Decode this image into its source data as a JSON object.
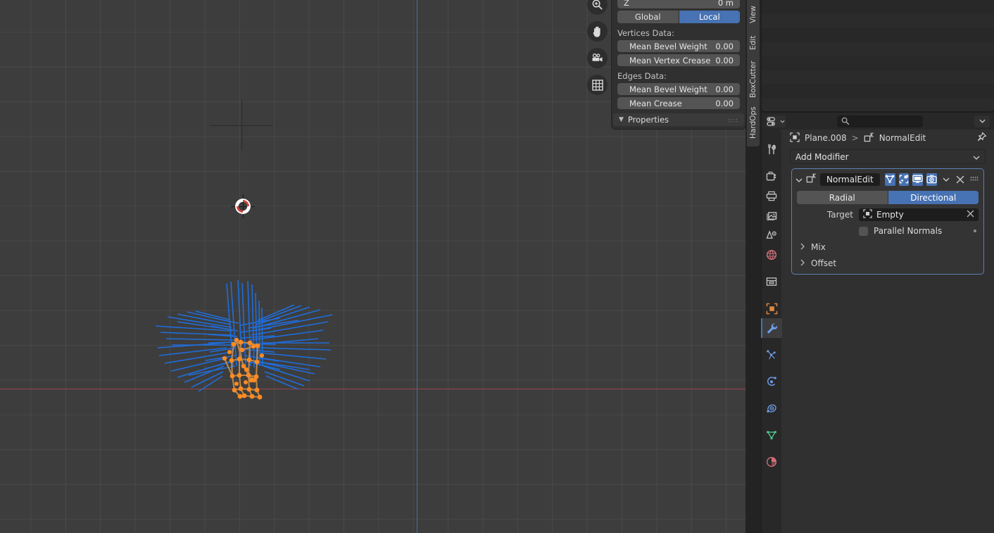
{
  "viewport": {
    "name": "3d-viewport",
    "background_color": "#3d3d3d",
    "grid_color": "#4a4a4a",
    "x_axis_color": "#9b4550",
    "z_axis_color": "#4a6fa0",
    "gizmos": [
      {
        "icon": "zoom-in-icon",
        "label": "Zoom"
      },
      {
        "icon": "hand-pan-icon",
        "label": "Move View"
      },
      {
        "icon": "camera-icon",
        "label": "Camera View"
      },
      {
        "icon": "grid-ortho-icon",
        "label": "Toggle Orthographic"
      }
    ],
    "mesh": {
      "normal_line_color": "#1f6fe0",
      "selected_vertex_color": "#ff8b22",
      "selected_edge_color": "#c98b4a",
      "cursor_3d": "red-white-3d-cursor",
      "empty_object": "plain-axes-empty"
    }
  },
  "sidebar_npanel": {
    "name": "n-panel",
    "transform": {
      "z_label": "Z",
      "z_value": "0 m",
      "orientation": {
        "global_label": "Global",
        "local_label": "Local",
        "active": "Local"
      }
    },
    "vertices_data": {
      "title": "Vertices Data:",
      "rows": [
        {
          "label": "Mean Bevel Weight",
          "value": "0.00"
        },
        {
          "label": "Mean Vertex Crease",
          "value": "0.00"
        }
      ]
    },
    "edges_data": {
      "title": "Edges Data:",
      "rows": [
        {
          "label": "Mean Bevel Weight",
          "value": "0.00"
        },
        {
          "label": "Mean Crease",
          "value": "0.00"
        }
      ]
    },
    "properties_section": {
      "title": "Properties",
      "expanded": true
    }
  },
  "vertical_tabs": {
    "name": "viewport-sidebar-tabs",
    "items": [
      {
        "label": "View"
      },
      {
        "label": "Edit"
      },
      {
        "label": "BoxCutter"
      },
      {
        "label": "HardOps"
      }
    ]
  },
  "properties_editor": {
    "header": {
      "editor_type_icon": "editor-type-properties-icon",
      "search_placeholder": "",
      "search_value": "",
      "filter_icon": "chevron-down-icon"
    },
    "breadcrumb": {
      "object_icon": "object-icon",
      "object_name": "Plane.008",
      "separator": ">",
      "modifier_icon": "normal-edit-modifier-icon",
      "modifier_name": "NormalEdit",
      "pin_icon": "pin-icon"
    },
    "tabs": [
      {
        "name": "tool",
        "icon": "tool-icon",
        "active": false,
        "color": "#c3c3c3"
      },
      {
        "name": "render",
        "icon": "render-camera-icon",
        "active": false,
        "color": "#c3c3c3"
      },
      {
        "name": "output",
        "icon": "printer-icon",
        "active": false,
        "color": "#c3c3c3"
      },
      {
        "name": "view-layer",
        "icon": "images-icon",
        "active": false,
        "color": "#c3c3c3"
      },
      {
        "name": "scene",
        "icon": "scene-cone-icon",
        "active": false,
        "color": "#c3c3c3"
      },
      {
        "name": "world",
        "icon": "world-globe-icon",
        "active": false,
        "color": "#cf6f77"
      },
      {
        "name": "collection",
        "icon": "collection-box-icon",
        "active": false,
        "color": "#c3c3c3"
      },
      {
        "name": "object",
        "icon": "object-square-icon",
        "active": false,
        "color": "#e08a3c"
      },
      {
        "name": "modifiers",
        "icon": "wrench-icon",
        "active": true,
        "color": "#6f9ee8"
      },
      {
        "name": "particles",
        "icon": "particles-icon",
        "active": false,
        "color": "#6f9ee8"
      },
      {
        "name": "physics",
        "icon": "physics-orbit-icon",
        "active": false,
        "color": "#6f9ee8"
      },
      {
        "name": "constraints",
        "icon": "constraint-icon",
        "active": false,
        "color": "#6f9ee8"
      },
      {
        "name": "object-data",
        "icon": "mesh-data-triangle-icon",
        "active": false,
        "color": "#4fc48a"
      },
      {
        "name": "material",
        "icon": "material-sphere-icon",
        "active": false,
        "color": "#cf6f77"
      }
    ],
    "add_modifier": {
      "label": "Add Modifier",
      "chevron": "chevron-down-icon"
    },
    "modifier": {
      "expand_chevron": "chevron-down-icon",
      "type_icon": "normal-edit-modifier-icon",
      "name": "NormalEdit",
      "toggles": [
        {
          "name": "edit-mode-display",
          "icon": "vertex-triangle-icon",
          "active": true
        },
        {
          "name": "on-cage-display",
          "icon": "on-cage-icon",
          "active": true
        },
        {
          "name": "realtime-display",
          "icon": "monitor-icon",
          "active": true
        },
        {
          "name": "render-display",
          "icon": "camera-icon",
          "active": true
        }
      ],
      "extras_icon": "chevron-down-icon",
      "close_icon": "close-x-icon",
      "drag_icon": "drag-dots-icon",
      "mode": {
        "radial_label": "Radial",
        "directional_label": "Directional",
        "active": "Directional"
      },
      "target": {
        "label": "Target",
        "icon": "object-icon",
        "value": "Empty",
        "clear_icon": "close-x-icon"
      },
      "parallel_normals": {
        "label": "Parallel Normals",
        "checked": false,
        "animate_decorator": "animate-dot-icon"
      },
      "subpanels": [
        {
          "label": "Mix",
          "expanded": false
        },
        {
          "label": "Offset",
          "expanded": false
        }
      ]
    }
  },
  "colors": {
    "accent_blue": "#4772b3",
    "panel_bg": "#303030",
    "header_bg": "#282828",
    "field_bg": "#545454",
    "dark_field": "#1d1d1d",
    "text": "#e5e5e5"
  }
}
